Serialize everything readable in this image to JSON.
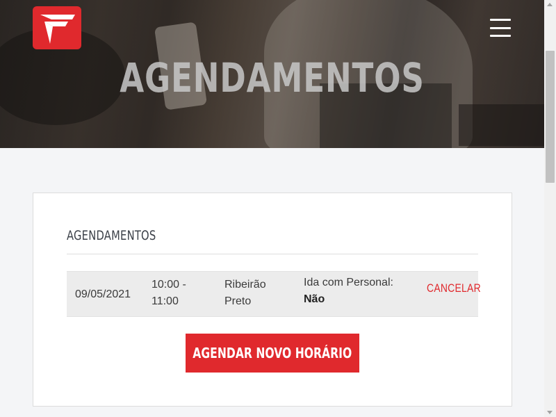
{
  "header": {
    "title": "AGENDAMENTOS",
    "logo_icon": "brand-logo-icon",
    "menu_icon": "hamburger-menu-icon"
  },
  "appointments": {
    "section_title": "AGENDAMENTOS",
    "rows": [
      {
        "date": "09/05/2021",
        "time": "10:00 - 11:00",
        "location": "Ribeirão Preto",
        "personal_label": "Ida com Personal:",
        "personal_value": "Não",
        "cancel_label": "CANCELAR"
      }
    ],
    "new_button_label": "AGENDAR NOVO HORÁRIO"
  },
  "colors": {
    "accent": "#e0292d",
    "page_bg": "#f4f5f7",
    "row_bg": "#ececec"
  }
}
